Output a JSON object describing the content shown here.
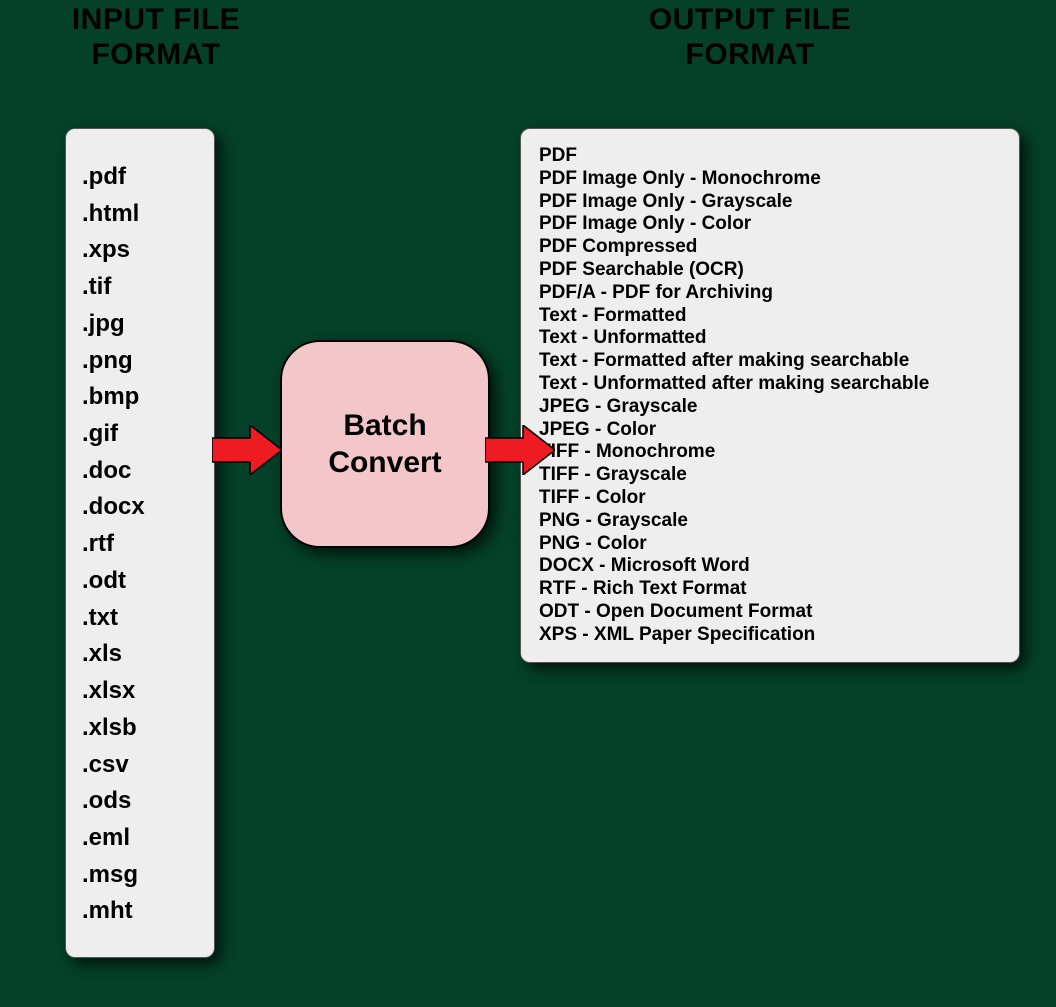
{
  "headings": {
    "input": "INPUT FILE FORMAT",
    "output": "OUTPUT FILE FORMAT"
  },
  "convert_label": "Batch\nConvert",
  "input_formats": [
    ".pdf",
    ".html",
    ".xps",
    ".tif",
    ".jpg",
    ".png",
    ".bmp",
    ".gif",
    ".doc",
    ".docx",
    ".rtf",
    ".odt",
    ".txt",
    ".xls",
    ".xlsx",
    ".xlsb",
    ".csv",
    ".ods",
    ".eml",
    ".msg",
    ".mht"
  ],
  "output_formats": [
    "PDF",
    "PDF Image Only - Monochrome",
    "PDF Image Only - Grayscale",
    "PDF Image Only - Color",
    "PDF Compressed",
    "PDF Searchable (OCR)",
    "PDF/A - PDF for Archiving",
    "Text - Formatted",
    "Text - Unformatted",
    "Text - Formatted after making searchable",
    "Text - Unformatted after making searchable",
    "JPEG - Grayscale",
    "JPEG - Color",
    "TIFF - Monochrome",
    "TIFF - Grayscale",
    "TIFF - Color",
    "PNG - Grayscale",
    "PNG - Color",
    "DOCX - Microsoft Word",
    "RTF - Rich Text Format",
    "ODT - Open Document Format",
    "XPS - XML Paper Specification"
  ]
}
